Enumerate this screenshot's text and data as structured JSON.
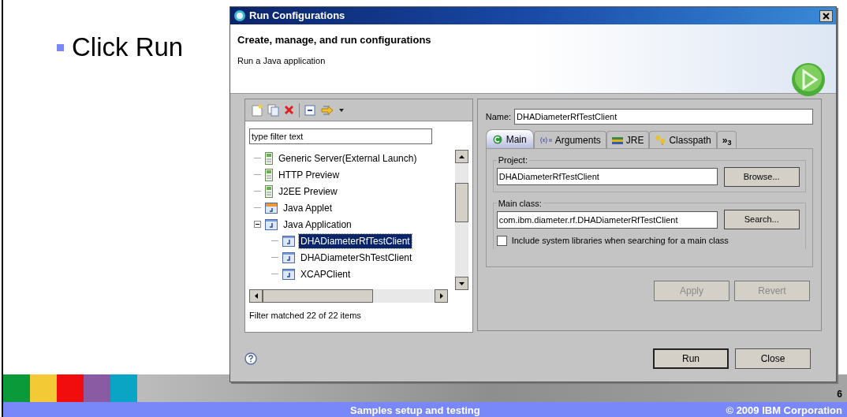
{
  "slide": {
    "bullet": "Click Run",
    "footer": "Samples setup and testing",
    "copyright": "© 2009 IBM Corporation",
    "page_number": "6"
  },
  "window": {
    "title": "Run Configurations",
    "heading": "Create, manage, and run configurations",
    "subtitle": "Run a Java application"
  },
  "sidebar": {
    "filter": {
      "placeholder": "type filter text"
    },
    "tree": [
      {
        "label": "Generic Server(External Launch)",
        "kind": "server",
        "selected": false
      },
      {
        "label": "HTTP Preview",
        "kind": "server",
        "selected": false
      },
      {
        "label": "J2EE Preview",
        "kind": "server",
        "selected": false
      },
      {
        "label": "Java Applet",
        "kind": "applet",
        "selected": false
      },
      {
        "label": "Java Application",
        "kind": "java",
        "selected": false,
        "expanded": true,
        "children": [
          {
            "label": "DHADiameterRfTestClient",
            "kind": "java",
            "selected": true
          },
          {
            "label": "DHADiameterShTestClient",
            "kind": "java",
            "selected": false
          },
          {
            "label": "XCAPClient",
            "kind": "java",
            "selected": false
          }
        ]
      }
    ],
    "status": "Filter matched 22 of 22 items"
  },
  "name": {
    "label": "Name:",
    "value": "DHADiameterRfTestClient"
  },
  "tabs": [
    {
      "label": "Main",
      "kind": "main",
      "selected": true
    },
    {
      "label": "Arguments",
      "kind": "arguments",
      "selected": false
    },
    {
      "label": "JRE",
      "kind": "jre",
      "selected": false
    },
    {
      "label": "Classpath",
      "kind": "classpath",
      "selected": false
    },
    {
      "label": "»$_{3}$",
      "kind": "overflow",
      "selected": false
    }
  ],
  "project": {
    "label": "Project:",
    "value": "DHADiameterRfTestClient",
    "button": "Browse..."
  },
  "main_class": {
    "label": "Main class:",
    "value": "com.ibm.diameter.rf.DHADiameterRfTestClient",
    "button": "Search...",
    "checkbox": {
      "label": "Include system libraries when searching for a main class",
      "checked": false
    }
  },
  "form_buttons": [
    {
      "label": "Apply",
      "disabled": true
    },
    {
      "label": "Revert",
      "disabled": true
    }
  ],
  "dialog_buttons": [
    {
      "label": "Run",
      "default": true
    },
    {
      "label": "Close",
      "default": false
    }
  ]
}
